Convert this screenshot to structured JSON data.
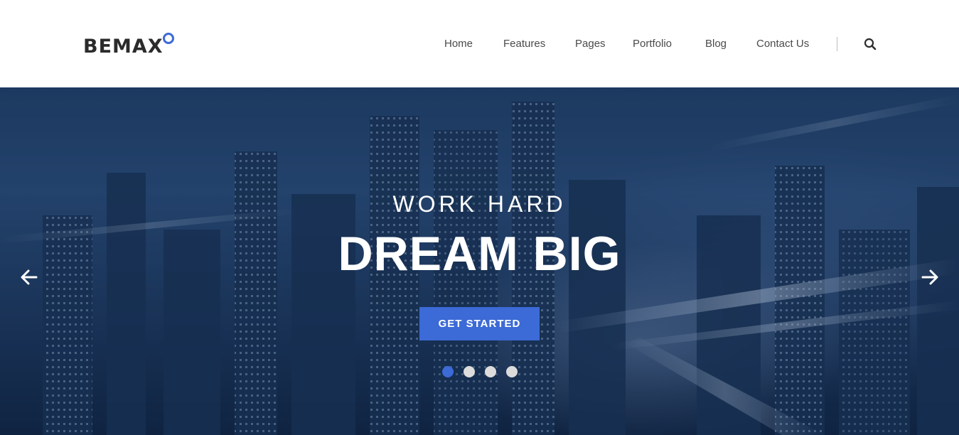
{
  "brand": {
    "name": "BEMAX",
    "accent_color": "#3c6ad6"
  },
  "nav": {
    "items": [
      {
        "label": "Home"
      },
      {
        "label": "Features"
      },
      {
        "label": "Pages"
      },
      {
        "label": "Portfolio"
      },
      {
        "label": "Blog"
      },
      {
        "label": "Contact Us"
      }
    ],
    "search_icon": "search-icon"
  },
  "hero": {
    "tagline": "WORK HARD",
    "title": "DREAM BIG",
    "cta_label": "GET STARTED",
    "prev_icon": "arrow-left-icon",
    "next_icon": "arrow-right-icon",
    "slides": {
      "count": 4,
      "active": 1
    }
  }
}
